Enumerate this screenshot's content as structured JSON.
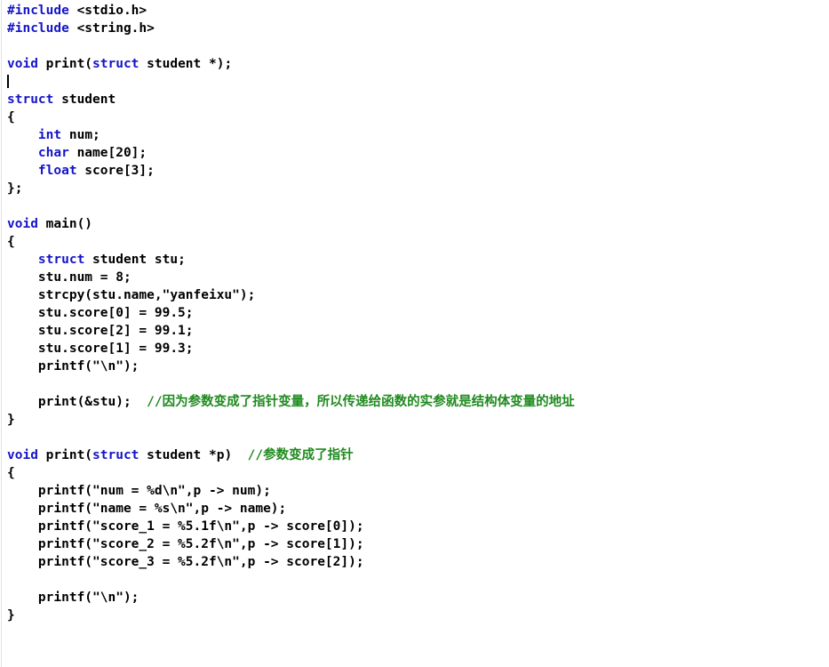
{
  "editor": {
    "language": "C",
    "background_color": "#ffffff",
    "keyword_color": "#1414c8",
    "text_color": "#000000",
    "comment_color": "#1f8a1f",
    "rule_color": "#e2e2e2",
    "caret_line_index": 3
  },
  "code": {
    "lines": [
      {
        "id": "l1",
        "tokens": [
          {
            "t": "kw",
            "v": "#include"
          },
          {
            "t": "plain",
            "v": " <stdio.h>"
          }
        ]
      },
      {
        "id": "l2",
        "tokens": [
          {
            "t": "kw",
            "v": "#include"
          },
          {
            "t": "plain",
            "v": " <string.h>"
          }
        ]
      },
      {
        "id": "l3",
        "tokens": []
      },
      {
        "id": "l4",
        "tokens": [
          {
            "t": "kw",
            "v": "void"
          },
          {
            "t": "plain",
            "v": " print("
          },
          {
            "t": "kw",
            "v": "struct"
          },
          {
            "t": "plain",
            "v": " student *);"
          }
        ]
      },
      {
        "id": "l5",
        "tokens": [],
        "caret": true
      },
      {
        "id": "l6",
        "tokens": [
          {
            "t": "kw",
            "v": "struct"
          },
          {
            "t": "plain",
            "v": " student"
          }
        ]
      },
      {
        "id": "l7",
        "tokens": [
          {
            "t": "plain",
            "v": "{"
          }
        ]
      },
      {
        "id": "l8",
        "tokens": [
          {
            "t": "plain",
            "v": "    "
          },
          {
            "t": "kw",
            "v": "int"
          },
          {
            "t": "plain",
            "v": " num;"
          }
        ]
      },
      {
        "id": "l9",
        "tokens": [
          {
            "t": "plain",
            "v": "    "
          },
          {
            "t": "kw",
            "v": "char"
          },
          {
            "t": "plain",
            "v": " name[20];"
          }
        ]
      },
      {
        "id": "l10",
        "tokens": [
          {
            "t": "plain",
            "v": "    "
          },
          {
            "t": "kw",
            "v": "float"
          },
          {
            "t": "plain",
            "v": " score[3];"
          }
        ]
      },
      {
        "id": "l11",
        "tokens": [
          {
            "t": "plain",
            "v": "};"
          }
        ]
      },
      {
        "id": "l12",
        "tokens": []
      },
      {
        "id": "l13",
        "tokens": [
          {
            "t": "kw",
            "v": "void"
          },
          {
            "t": "plain",
            "v": " main()"
          }
        ]
      },
      {
        "id": "l14",
        "tokens": [
          {
            "t": "plain",
            "v": "{"
          }
        ]
      },
      {
        "id": "l15",
        "tokens": [
          {
            "t": "plain",
            "v": "    "
          },
          {
            "t": "kw",
            "v": "struct"
          },
          {
            "t": "plain",
            "v": " student stu;"
          }
        ]
      },
      {
        "id": "l16",
        "tokens": [
          {
            "t": "plain",
            "v": "    stu.num = 8;"
          }
        ]
      },
      {
        "id": "l17",
        "tokens": [
          {
            "t": "plain",
            "v": "    strcpy(stu.name,\"yanfeixu\");"
          }
        ]
      },
      {
        "id": "l18",
        "tokens": [
          {
            "t": "plain",
            "v": "    stu.score[0] = 99.5;"
          }
        ]
      },
      {
        "id": "l19",
        "tokens": [
          {
            "t": "plain",
            "v": "    stu.score[2] = 99.1;"
          }
        ]
      },
      {
        "id": "l20",
        "tokens": [
          {
            "t": "plain",
            "v": "    stu.score[1] = 99.3;"
          }
        ]
      },
      {
        "id": "l21",
        "tokens": [
          {
            "t": "plain",
            "v": "    printf(\"\\n\");"
          }
        ]
      },
      {
        "id": "l22",
        "tokens": []
      },
      {
        "id": "l23",
        "tokens": [
          {
            "t": "plain",
            "v": "    print(&stu);  "
          },
          {
            "t": "comment",
            "v": "//因为参数变成了指针变量，所以传递给函数的实参就是结构体变量的地址"
          }
        ]
      },
      {
        "id": "l24",
        "tokens": [
          {
            "t": "plain",
            "v": "}"
          }
        ]
      },
      {
        "id": "l25",
        "tokens": []
      },
      {
        "id": "l26",
        "tokens": [
          {
            "t": "kw",
            "v": "void"
          },
          {
            "t": "plain",
            "v": " print("
          },
          {
            "t": "kw",
            "v": "struct"
          },
          {
            "t": "plain",
            "v": " student *p)  "
          },
          {
            "t": "comment",
            "v": "//参数变成了指针"
          }
        ]
      },
      {
        "id": "l27",
        "tokens": [
          {
            "t": "plain",
            "v": "{"
          }
        ]
      },
      {
        "id": "l28",
        "tokens": [
          {
            "t": "plain",
            "v": "    printf(\"num = %d\\n\",p -> num);"
          }
        ]
      },
      {
        "id": "l29",
        "tokens": [
          {
            "t": "plain",
            "v": "    printf(\"name = %s\\n\",p -> name);"
          }
        ]
      },
      {
        "id": "l30",
        "tokens": [
          {
            "t": "plain",
            "v": "    printf(\"score_1 = %5.1f\\n\",p -> score[0]);"
          }
        ]
      },
      {
        "id": "l31",
        "tokens": [
          {
            "t": "plain",
            "v": "    printf(\"score_2 = %5.2f\\n\",p -> score[1]);"
          }
        ]
      },
      {
        "id": "l32",
        "tokens": [
          {
            "t": "plain",
            "v": "    printf(\"score_3 = %5.2f\\n\",p -> score[2]);"
          }
        ]
      },
      {
        "id": "l33",
        "tokens": []
      },
      {
        "id": "l34",
        "tokens": [
          {
            "t": "plain",
            "v": "    printf(\"\\n\");"
          }
        ]
      },
      {
        "id": "l35",
        "tokens": [
          {
            "t": "plain",
            "v": "}"
          }
        ]
      }
    ]
  }
}
